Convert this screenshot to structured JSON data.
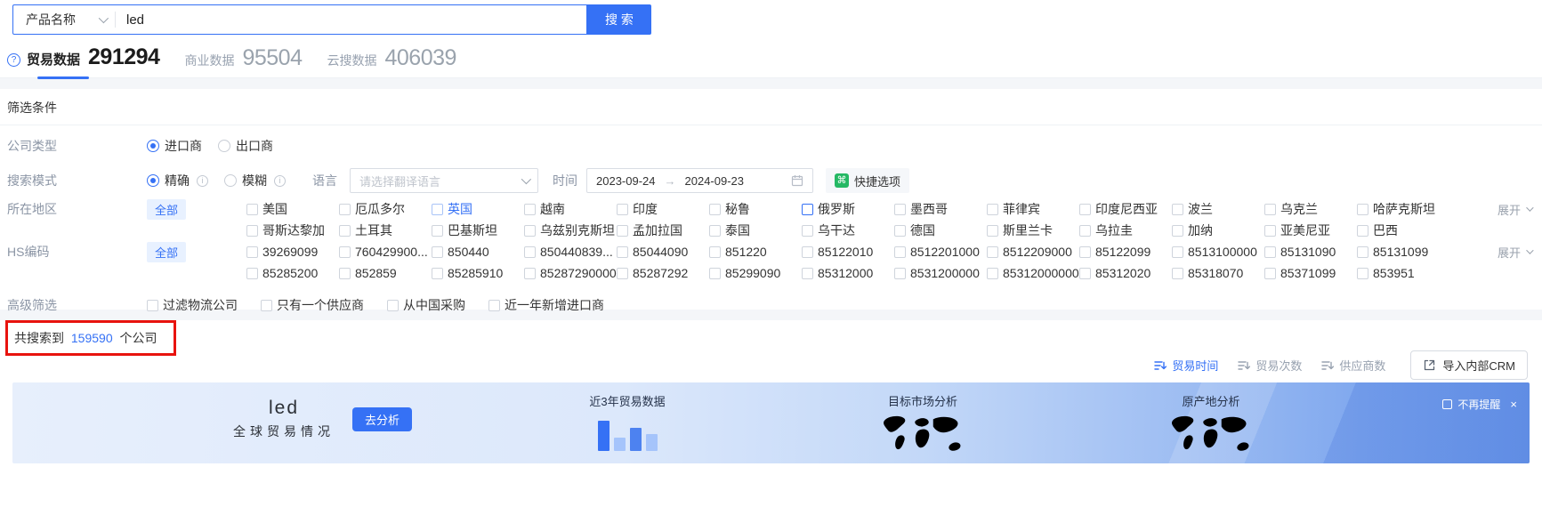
{
  "search": {
    "field_label": "产品名称",
    "query": "led",
    "button_label": "搜 索"
  },
  "tabs": [
    {
      "label": "贸易数据",
      "count": "291294",
      "active": true
    },
    {
      "label": "商业数据",
      "count": "95504",
      "active": false
    },
    {
      "label": "云搜数据",
      "count": "406039",
      "active": false
    }
  ],
  "filters": {
    "title": "筛选条件",
    "company_type": {
      "label": "公司类型",
      "options": [
        {
          "label": "进口商",
          "selected": true
        },
        {
          "label": "出口商",
          "selected": false
        }
      ]
    },
    "search_mode": {
      "label": "搜索模式",
      "options": [
        {
          "label": "精确",
          "selected": true
        },
        {
          "label": "模糊",
          "selected": false
        }
      ],
      "language_label": "语言",
      "language_placeholder": "请选择翻译语言",
      "time_label": "时间",
      "date_start": "2023-09-24",
      "date_separator": "→",
      "date_end": "2024-09-23",
      "quick_options_label": "快捷选项"
    },
    "region": {
      "label": "所在地区",
      "all_label": "全部",
      "expand_label": "展开",
      "row1": [
        {
          "label": "美国"
        },
        {
          "label": "厄瓜多尔"
        },
        {
          "label": "英国",
          "text_highlight": true,
          "box_soft": true
        },
        {
          "label": "越南"
        },
        {
          "label": "印度"
        },
        {
          "label": "秘鲁"
        },
        {
          "label": "俄罗斯",
          "box_highlight": true
        },
        {
          "label": "墨西哥"
        },
        {
          "label": "菲律宾"
        },
        {
          "label": "印度尼西亚"
        },
        {
          "label": "波兰"
        },
        {
          "label": "乌克兰"
        },
        {
          "label": "哈萨克斯坦"
        }
      ],
      "row2": [
        {
          "label": "哥斯达黎加"
        },
        {
          "label": "土耳其"
        },
        {
          "label": "巴基斯坦"
        },
        {
          "label": "乌兹别克斯坦"
        },
        {
          "label": "孟加拉国"
        },
        {
          "label": "泰国"
        },
        {
          "label": "乌干达"
        },
        {
          "label": "德国"
        },
        {
          "label": "斯里兰卡"
        },
        {
          "label": "乌拉圭"
        },
        {
          "label": "加纳"
        },
        {
          "label": "亚美尼亚"
        },
        {
          "label": "巴西"
        }
      ]
    },
    "hs_code": {
      "label": "HS编码",
      "all_label": "全部",
      "expand_label": "展开",
      "row1": [
        "39269099",
        "760429900...",
        "850440",
        "850440839...",
        "85044090",
        "851220",
        "85122010",
        "8512201000",
        "8512209000",
        "85122099",
        "8513100000",
        "85131090",
        "85131099"
      ],
      "row2": [
        "85285200",
        "852859",
        "85285910",
        "85287290000",
        "85287292",
        "85299090",
        "85312000",
        "8531200000",
        "85312000000",
        "85312020",
        "85318070",
        "85371099",
        "853951"
      ]
    },
    "advanced": {
      "label": "高级筛选",
      "options": [
        "过滤物流公司",
        "只有一个供应商",
        "从中国采购",
        "近一年新增进口商"
      ]
    }
  },
  "results": {
    "count_prefix": "共搜索到",
    "count": "159590",
    "count_suffix": "个公司",
    "sorts": [
      {
        "label": "贸易时间",
        "active": true
      },
      {
        "label": "贸易次数",
        "active": false
      },
      {
        "label": "供应商数",
        "active": false
      }
    ],
    "crm_button": "导入内部CRM"
  },
  "banner": {
    "keyword": "led",
    "subtitle": "全球贸易情况",
    "analyze_button": "去分析",
    "features": [
      {
        "label": "近3年贸易数据"
      },
      {
        "label": "目标市场分析"
      },
      {
        "label": "原产地分析"
      }
    ],
    "dismiss_label": "不再提醒",
    "close_label": "×"
  },
  "colors": {
    "accent": "#3571f5",
    "accent_bg": "#e8f1ff",
    "annotation_red": "#e8130e",
    "quick_icon_green": "#25b864"
  }
}
